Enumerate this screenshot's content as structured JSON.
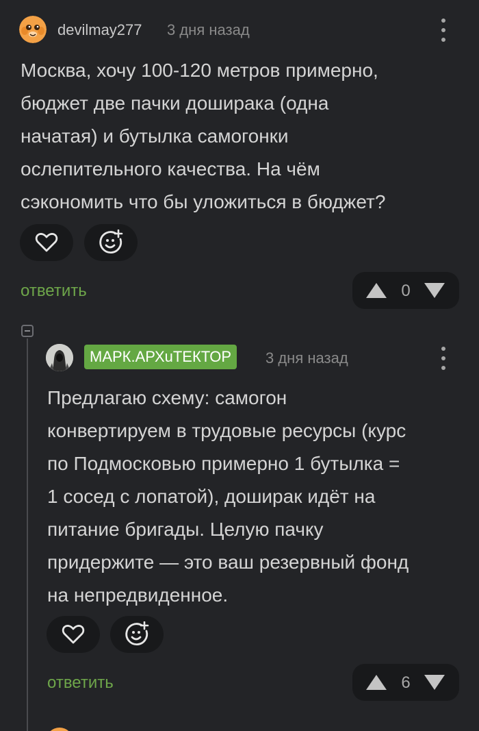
{
  "comment1": {
    "username": "devilmay277",
    "time": "3 дня назад",
    "text": "Москва, хочу 100-120 метров примерно,\nбюджет две пачки доширака (одна\nначатая) и бутылка самогонки\nослепительного качества. На чём\nсэкономить что бы уложиться в бюджет?",
    "reply_label": "ответить",
    "rating": "0"
  },
  "comment2": {
    "username": "МАРК.АРХuТЕКТОР",
    "time": "3 дня назад",
    "text": "Предлагаю схему: самогон\nконвертируем в трудовые ресурсы (курс\nпо Подмосковью примерно 1 бутылка =\n1 сосед с лопатой), доширак идёт на\nпитание бригады. Целую пачку\nпридержите — это ваш резервный фонд\nна непредвиденное.",
    "reply_label": "ответить",
    "rating": "6"
  },
  "colors": {
    "background": "#232427",
    "reply_link": "#6ea64a",
    "author_badge": "#64a843",
    "button_bg": "#18191b"
  },
  "icons": [
    "kebab-menu-icon",
    "heart-icon",
    "emoji-add-icon",
    "arrow-up-icon",
    "arrow-down-icon",
    "collapse-icon"
  ]
}
